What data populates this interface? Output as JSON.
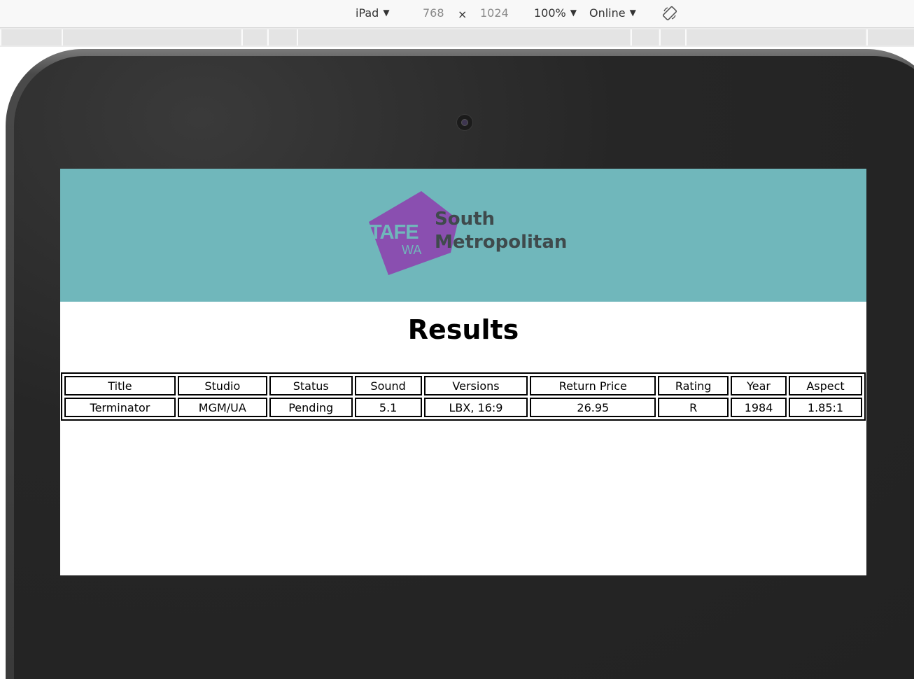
{
  "devtools": {
    "device": "iPad",
    "width": "768",
    "times": "×",
    "height": "1024",
    "zoom": "100%",
    "network": "Online"
  },
  "banner": {
    "bg_color": "#70b7bb",
    "logo_mark_text_1": "TAFE",
    "logo_mark_text_2": "WA",
    "logo_line_1": "South",
    "logo_line_2": "Metropolitan"
  },
  "page": {
    "title": "Results"
  },
  "table": {
    "headers": [
      "Title",
      "Studio",
      "Status",
      "Sound",
      "Versions",
      "Return Price",
      "Rating",
      "Year",
      "Aspect"
    ],
    "rows": [
      [
        "Terminator",
        "MGM/UA",
        "Pending",
        "5.1",
        "LBX, 16:9",
        "26.95",
        "R",
        "1984",
        "1.85:1"
      ]
    ]
  }
}
